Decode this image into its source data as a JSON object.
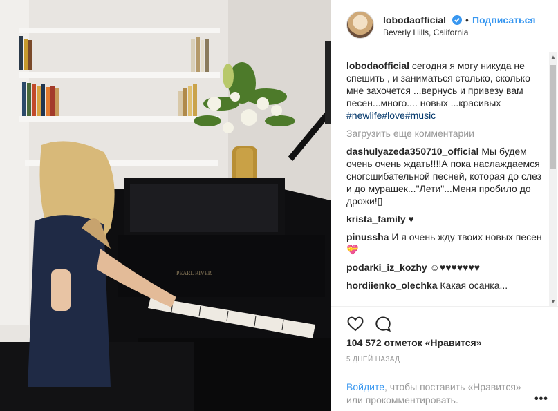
{
  "post": {
    "username": "lobodaofficial",
    "follow_label": "Подписаться",
    "dot": "•",
    "location": "Beverly Hills, California"
  },
  "comments": {
    "caption_user": "lobodaofficial",
    "caption_text": " сегодня я могу никуда не спешить , и заниматься столько, сколько мне захочется ...вернусь и привезу вам песен...много.... новых ...красивых ",
    "caption_tags": "#newlife#love#music",
    "load_more": "Загрузить еще комментарии",
    "items": [
      {
        "user": "dashulyazeda350710_official",
        "text": " Мы будем очень очень ждать!!!!А пока наслаждаемся сногсшибательной песней, которая до слез и до мурашек...\"Лети\"...Меня пробило до дрожи!▯"
      },
      {
        "user": "krista_family",
        "text": " ♥"
      },
      {
        "user": "pinussha",
        "text": " И я очень жду твоих новых песен💝"
      },
      {
        "user": "podarki_iz_kozhy",
        "text": " ☺♥♥♥♥♥♥♥"
      },
      {
        "user": "hordiienko_olechka",
        "text": " Какая осанка..."
      }
    ]
  },
  "actions": {
    "like_icon": "heart-icon",
    "comment_icon": "comment-icon",
    "likes_text": "104 572 отметок «Нравится»",
    "time_text": "5 ДНЕЙ НАЗАД"
  },
  "login": {
    "link_text": "Войдите",
    "rest_text": ", чтобы поставить «Нравится» или прокомментировать.",
    "more_label": "•••"
  },
  "colors": {
    "accent": "#3897f0",
    "hashtag": "#003569",
    "muted": "#999999"
  }
}
